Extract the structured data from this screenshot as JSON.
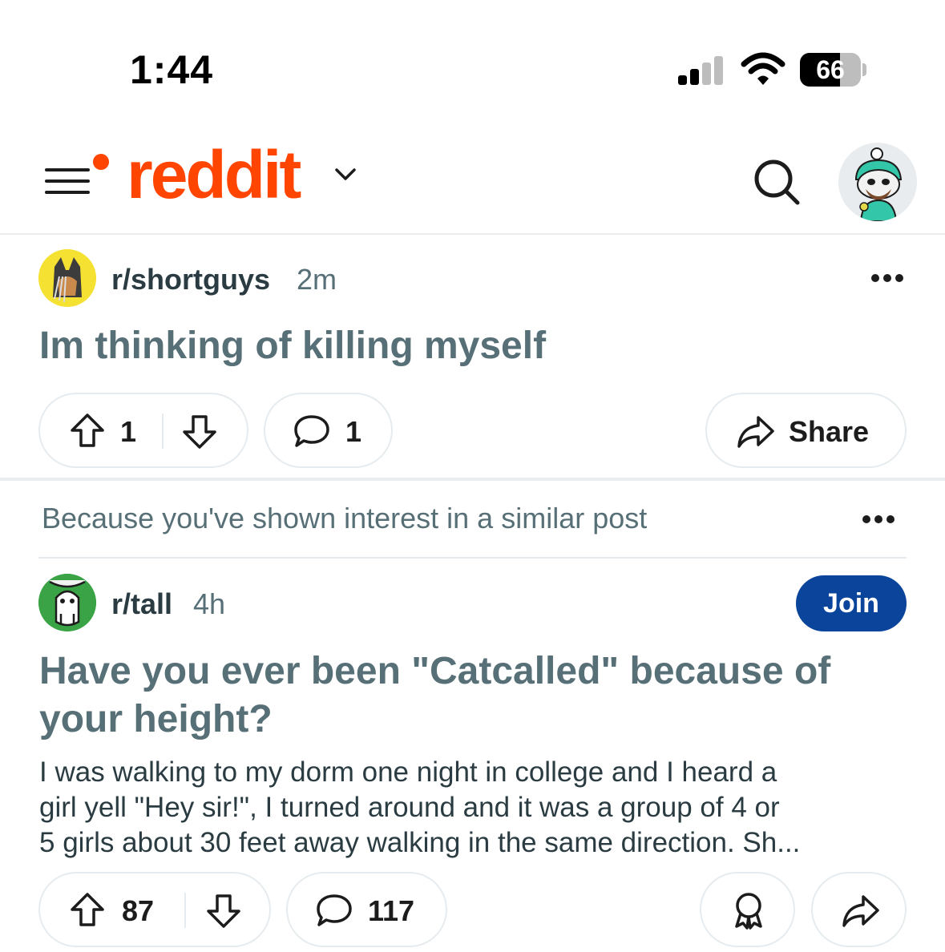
{
  "status_bar": {
    "time": "1:44",
    "battery_percent": "66",
    "battery_level": 0.66
  },
  "header": {
    "logo": "reddit",
    "icons": [
      "menu-icon",
      "chevron-down-icon",
      "search-icon",
      "user-avatar"
    ],
    "brand_color": "#ff4500"
  },
  "posts": [
    {
      "subreddit": "r/shortguys",
      "age": "2m",
      "title": "Im thinking of killing myself",
      "upvotes": "1",
      "comments": "1",
      "share_label": "Share"
    },
    {
      "recommendation": "Because you've shown interest in a similar post",
      "subreddit": "r/tall",
      "age": "4h",
      "join_label": "Join",
      "title_line1": "Have you ever been \"Catcalled\" because of",
      "title_line2": "your height?",
      "body_line1": "I was walking to my dorm one night in college and I heard a",
      "body_line2": "girl yell \"Hey sir!\", I turned around and it was a group of 4 or",
      "body_line3": "5 girls about 30 feet away walking in the same direction. Sh...",
      "upvotes": "87",
      "comments": "117"
    }
  ],
  "colors": {
    "join_button": "#0a449b",
    "title_text": "#576f76",
    "pill_border": "#e5ebee"
  }
}
